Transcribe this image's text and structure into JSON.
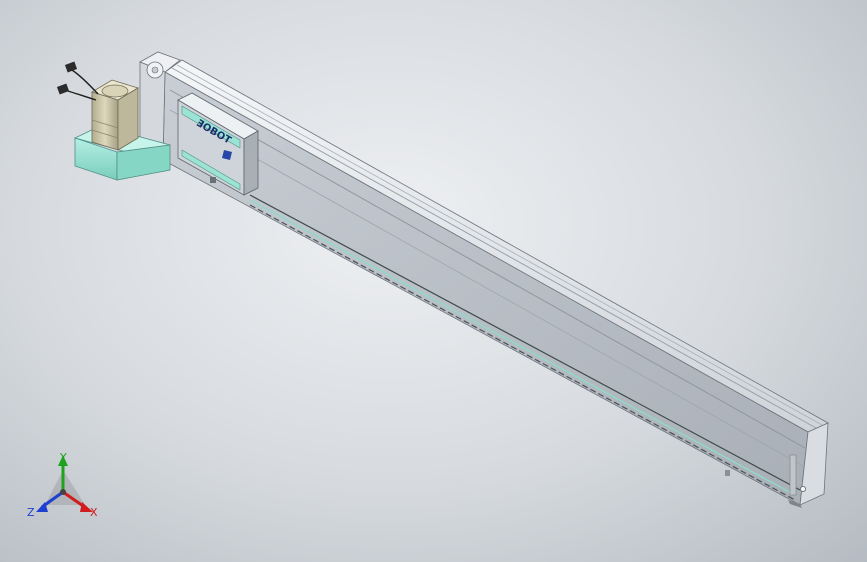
{
  "viewport": {
    "background_top": "#eef0f3",
    "background_bottom": "#b5bbc2"
  },
  "model": {
    "carriage_logo_text": "ƎOBOT",
    "colors": {
      "profile_light": "#dde1e6",
      "profile_mid": "#b9bfc7",
      "profile_dark": "#8d949c",
      "accent_teal": "#9be3d5",
      "motor": "#c8c2a6"
    }
  },
  "triad": {
    "y_label": "Y",
    "x_label": "X",
    "z_label": "Z",
    "y_color": "#1fa31f",
    "x_color": "#d01e1e",
    "z_color": "#1e3fd0"
  }
}
